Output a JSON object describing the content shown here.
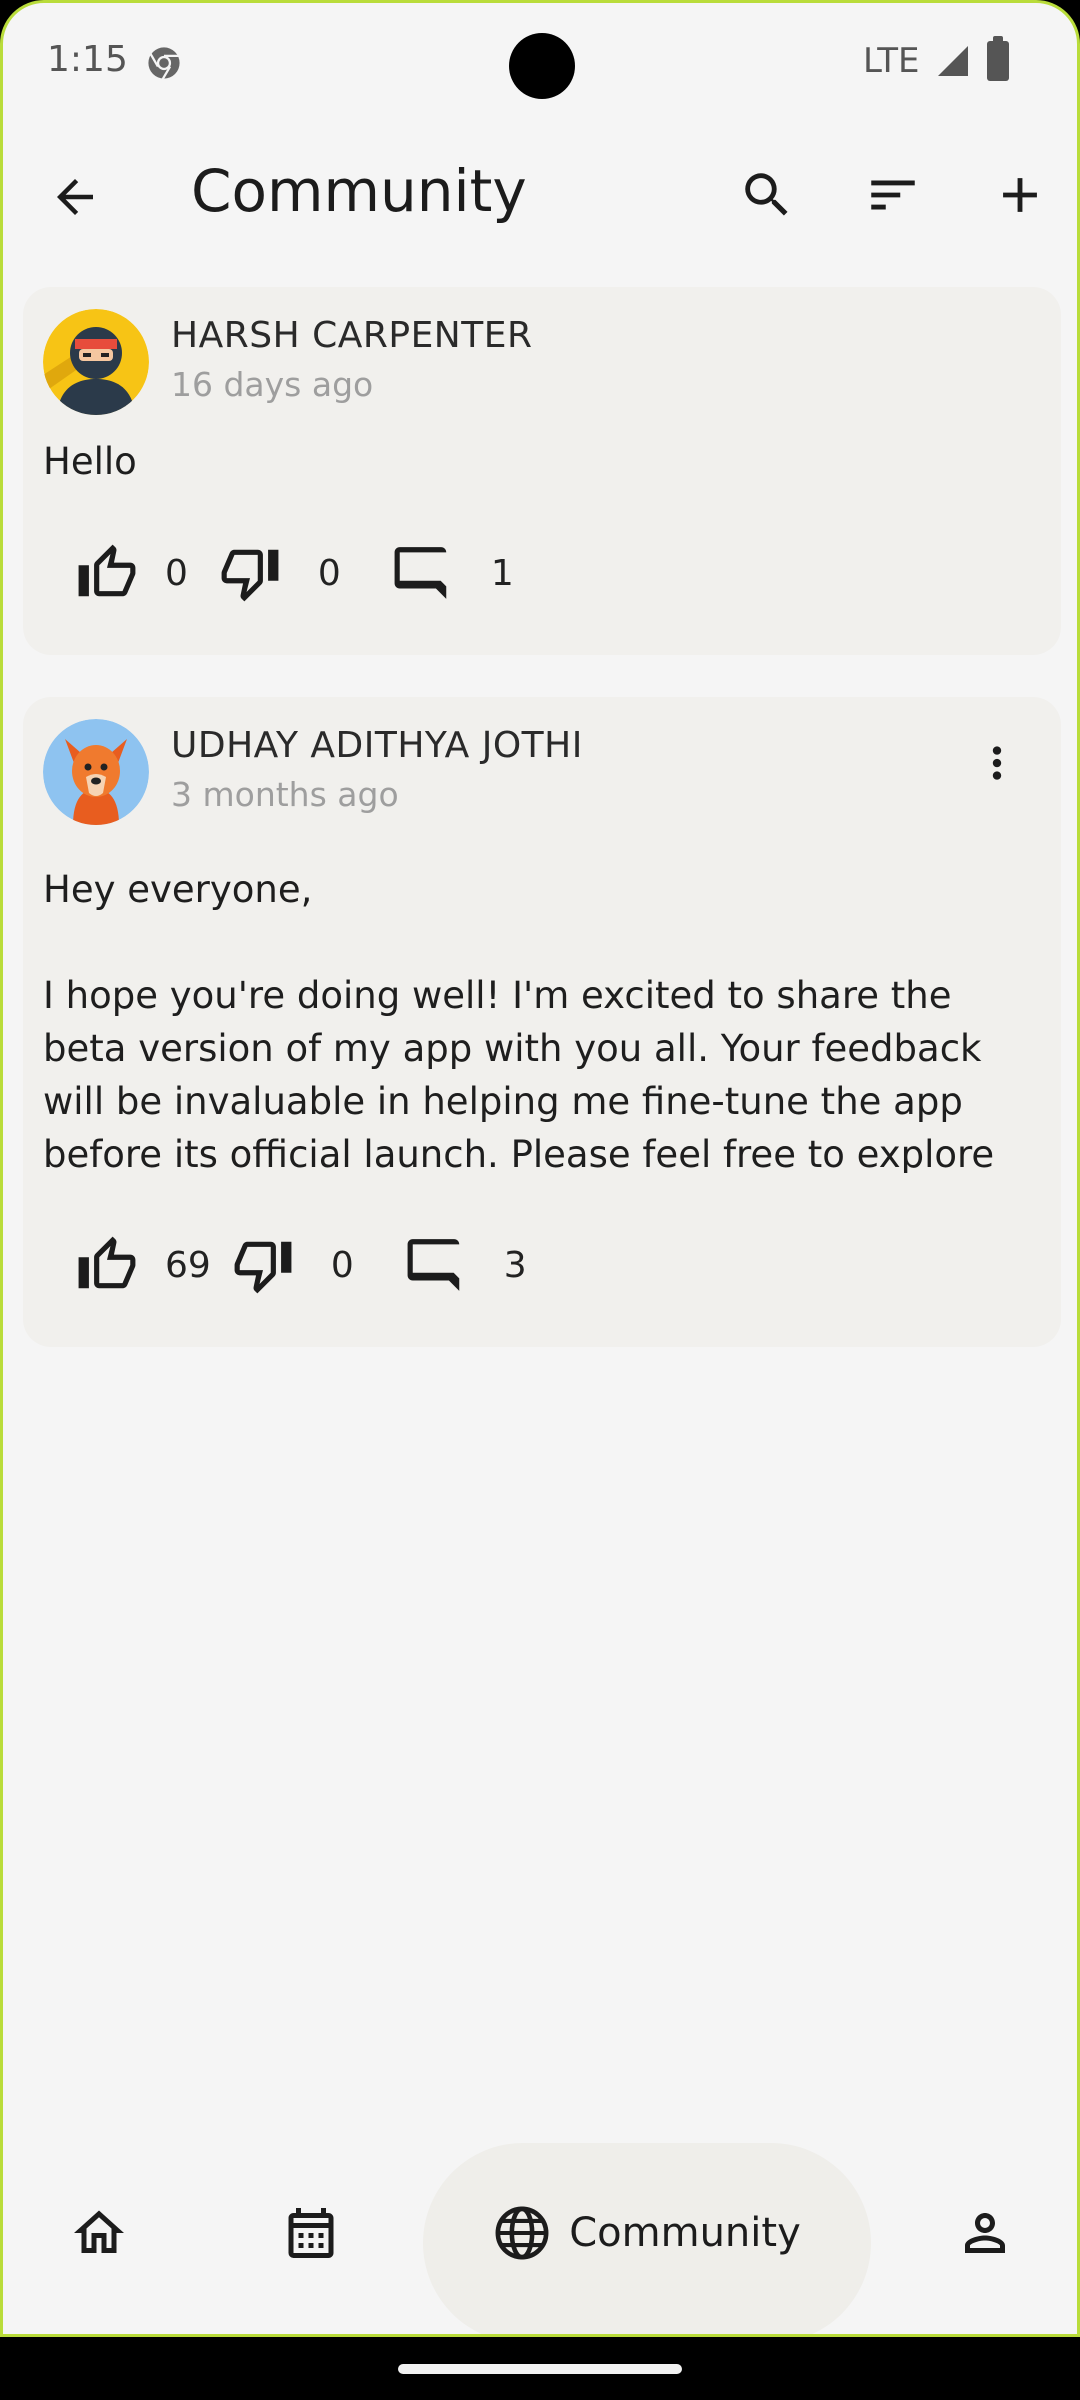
{
  "status_bar": {
    "time": "1:15",
    "network": "LTE"
  },
  "app_bar": {
    "title": "Community"
  },
  "posts": [
    {
      "author": "HARSH CARPENTER",
      "timestamp": "16 days ago",
      "body": "Hello",
      "likes": "0",
      "dislikes": "0",
      "comments": "1"
    },
    {
      "author": "UDHAY ADITHYA  JOTHI",
      "timestamp": "3 months ago",
      "body": "Hey everyone,\n\nI hope you're doing well! I'm excited to share the beta version of my app with you all. Your feedback will be invaluable in helping me fine-tune the app before its official launch. Please feel free to explore",
      "likes": "69",
      "dislikes": "0",
      "comments": "3"
    }
  ],
  "bottom_nav": {
    "active_label": "Community"
  },
  "colors": {
    "frame_accent": "#b9dc3a",
    "background": "#f5f5f5",
    "card": "#f1f0ed"
  }
}
